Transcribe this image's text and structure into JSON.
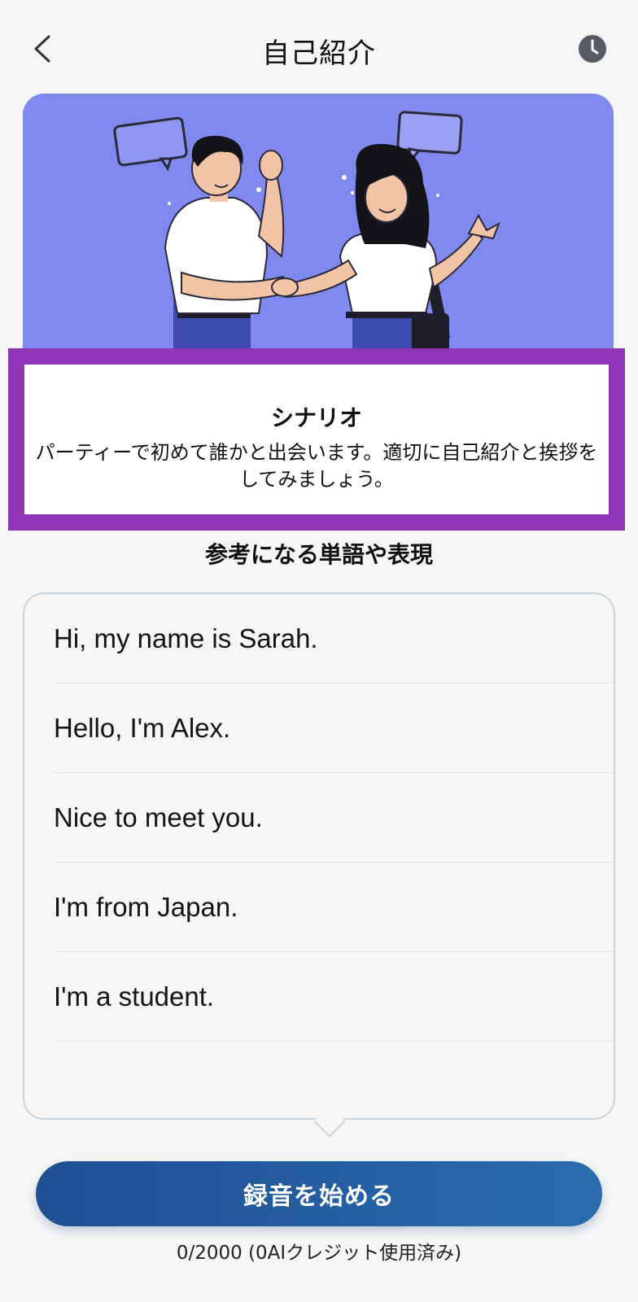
{
  "header": {
    "title": "自己紹介",
    "back_icon": "chevron-left-icon",
    "history_icon": "clock-icon"
  },
  "hero": {
    "background_color": "#8089ee",
    "illustration": "two-people-handshake-illustration"
  },
  "scenario": {
    "title": "シナリオ",
    "text": "パーティーで初めて誰かと出会います。適切に自己紹介と挨拶をしてみましょう。",
    "highlight_color": "#8e35b5"
  },
  "phrases": {
    "title": "参考になる単語や表現",
    "items": [
      "Hi, my name is Sarah.",
      "Hello, I'm Alex.",
      "Nice to meet you.",
      "I'm from Japan.",
      "I'm a student."
    ]
  },
  "actions": {
    "record_label": "録音を始める",
    "credits": "0/2000 (0AIクレジット使用済み)"
  },
  "colors": {
    "accent_start": "#1f4f92",
    "accent_end": "#2a6cad"
  }
}
